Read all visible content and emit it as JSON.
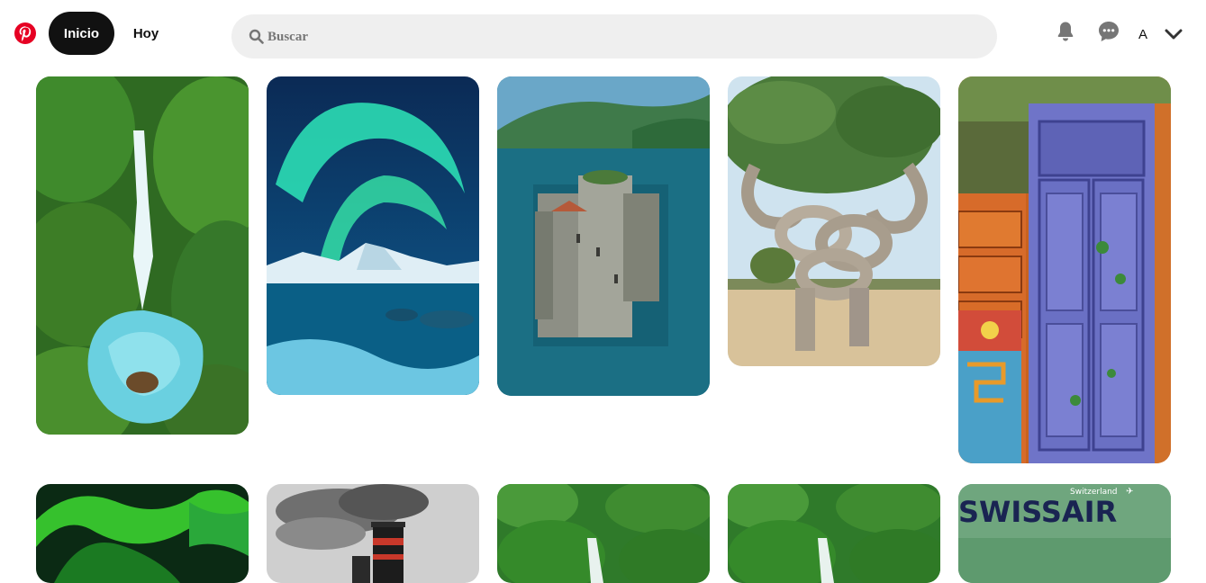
{
  "header": {
    "logo_icon": "pinterest-logo-icon",
    "nav": [
      {
        "label": "Inicio",
        "active": true
      },
      {
        "label": "Hoy",
        "active": false
      }
    ],
    "search": {
      "placeholder": "Buscar",
      "icon": "search-icon"
    },
    "icons": [
      "bell-icon",
      "chat-icon",
      "chevron-down-icon"
    ],
    "avatar_letter": "A"
  },
  "colors": {
    "brand": "#e60023",
    "active_nav": "#111111",
    "search_bg": "#efefef"
  },
  "pins": [
    {
      "subject": "waterfall-jungle"
    },
    {
      "subject": "aurora-lake"
    },
    {
      "subject": "castle-lake"
    },
    {
      "subject": "knotted-tree"
    },
    {
      "subject": "blue-door"
    },
    {
      "subject": "green-aurora"
    },
    {
      "subject": "steam-locomotive"
    },
    {
      "subject": "forest-waterfall"
    },
    {
      "subject": "forest-waterfall"
    },
    {
      "subject": "swissair-poster",
      "brand_text": "SWISSAIR",
      "sub_text": "Switzerland"
    }
  ]
}
